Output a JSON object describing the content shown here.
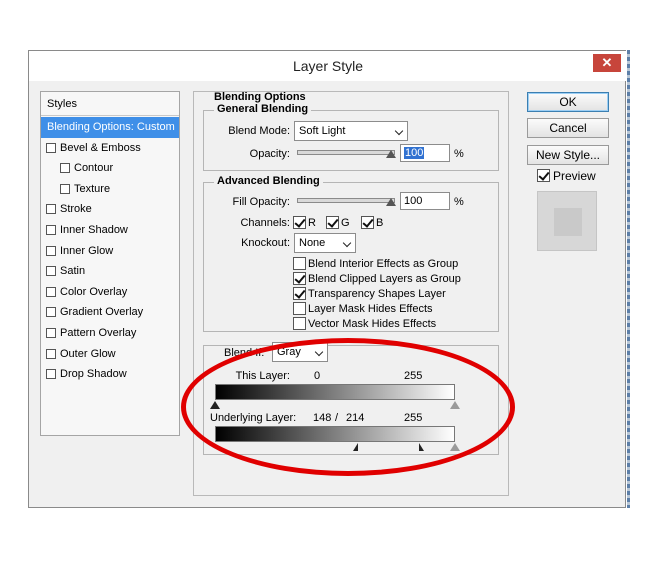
{
  "window": {
    "title": "Layer Style",
    "close_glyph": "✕"
  },
  "styles_panel": {
    "header": "Styles",
    "items": [
      {
        "label": "Blending Options: Custom",
        "active": true
      },
      {
        "label": "Bevel & Emboss",
        "checked": false
      },
      {
        "label": "Contour",
        "checked": false,
        "indent": true
      },
      {
        "label": "Texture",
        "checked": false,
        "indent": true
      },
      {
        "label": "Stroke",
        "checked": false
      },
      {
        "label": "Inner Shadow",
        "checked": false
      },
      {
        "label": "Inner Glow",
        "checked": false
      },
      {
        "label": "Satin",
        "checked": false
      },
      {
        "label": "Color Overlay",
        "checked": false
      },
      {
        "label": "Gradient Overlay",
        "checked": false
      },
      {
        "label": "Pattern Overlay",
        "checked": false
      },
      {
        "label": "Outer Glow",
        "checked": false
      },
      {
        "label": "Drop Shadow",
        "checked": false
      }
    ]
  },
  "blending_options": {
    "title": "Blending Options",
    "general": {
      "title": "General Blending",
      "blend_mode_label": "Blend Mode:",
      "blend_mode_value": "Soft Light",
      "opacity_label": "Opacity:",
      "opacity_value": "100",
      "opacity_unit": "%"
    },
    "advanced": {
      "title": "Advanced Blending",
      "fill_opacity_label": "Fill Opacity:",
      "fill_opacity_value": "100",
      "fill_opacity_unit": "%",
      "channels_label": "Channels:",
      "channels": [
        {
          "label": "R",
          "checked": true
        },
        {
          "label": "G",
          "checked": true
        },
        {
          "label": "B",
          "checked": true
        }
      ],
      "knockout_label": "Knockout:",
      "knockout_value": "None",
      "options": [
        {
          "label": "Blend Interior Effects as Group",
          "checked": false
        },
        {
          "label": "Blend Clipped Layers as Group",
          "checked": true
        },
        {
          "label": "Transparency Shapes Layer",
          "checked": true
        },
        {
          "label": "Layer Mask Hides Effects",
          "checked": false
        },
        {
          "label": "Vector Mask Hides Effects",
          "checked": false
        }
      ]
    },
    "blend_if": {
      "label": "Blend If:",
      "value": "Gray",
      "this_layer_label": "This Layer:",
      "this_layer_low": "0",
      "this_layer_high": "255",
      "underlying_label": "Underlying Layer:",
      "underlying_low": "148",
      "underlying_sep": "/",
      "underlying_mid": "214",
      "underlying_high": "255"
    }
  },
  "buttons": {
    "ok": "OK",
    "cancel": "Cancel",
    "new_style": "New Style...",
    "preview_label": "Preview",
    "preview_checked": true
  },
  "colors": {
    "active_item": "#3f8fe8",
    "annotation": "#e00000",
    "close_button": "#c7453b"
  }
}
